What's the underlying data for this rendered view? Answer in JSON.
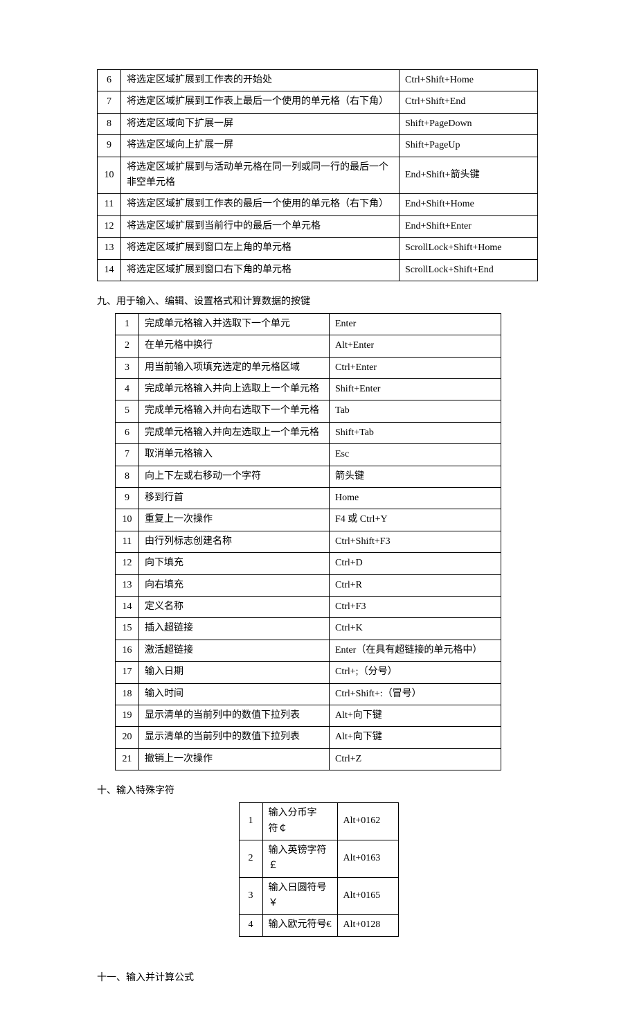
{
  "table1": {
    "rows": [
      {
        "num": "6",
        "desc": "将选定区域扩展到工作表的开始处",
        "key": "Ctrl+Shift+Home"
      },
      {
        "num": "7",
        "desc": "将选定区域扩展到工作表上最后一个使用的单元格（右下角）",
        "key": "Ctrl+Shift+End"
      },
      {
        "num": "8",
        "desc": "将选定区域向下扩展一屏",
        "key": "Shift+PageDown"
      },
      {
        "num": "9",
        "desc": "将选定区域向上扩展一屏",
        "key": "Shift+PageUp"
      },
      {
        "num": "10",
        "desc": "将选定区域扩展到与活动单元格在同一列或同一行的最后一个非空单元格",
        "key": "End+Shift+箭头键"
      },
      {
        "num": "11",
        "desc": "将选定区域扩展到工作表的最后一个使用的单元格（右下角）",
        "key": "End+Shift+Home"
      },
      {
        "num": "12",
        "desc": "将选定区域扩展到当前行中的最后一个单元格",
        "key": "End+Shift+Enter"
      },
      {
        "num": "13",
        "desc": "将选定区域扩展到窗口左上角的单元格",
        "key": "ScrollLock+Shift+Home"
      },
      {
        "num": "14",
        "desc": "将选定区域扩展到窗口右下角的单元格",
        "key": "ScrollLock+Shift+End"
      }
    ]
  },
  "section9": {
    "title": "九、用于输入、编辑、设置格式和计算数据的按键",
    "rows": [
      {
        "num": "1",
        "desc": "完成单元格输入并选取下一个单元",
        "key": "Enter"
      },
      {
        "num": "2",
        "desc": "在单元格中换行",
        "key": "Alt+Enter"
      },
      {
        "num": "3",
        "desc": "用当前输入项填充选定的单元格区域",
        "key": "Ctrl+Enter"
      },
      {
        "num": "4",
        "desc": "完成单元格输入并向上选取上一个单元格",
        "key": "Shift+Enter"
      },
      {
        "num": "5",
        "desc": "完成单元格输入并向右选取下一个单元格",
        "key": "Tab"
      },
      {
        "num": "6",
        "desc": "完成单元格输入并向左选取上一个单元格",
        "key": "Shift+Tab"
      },
      {
        "num": "7",
        "desc": "取消单元格输入",
        "key": "Esc"
      },
      {
        "num": "8",
        "desc": "向上下左或右移动一个字符",
        "key": "箭头键"
      },
      {
        "num": "9",
        "desc": "移到行首",
        "key": "Home"
      },
      {
        "num": "10",
        "desc": "重复上一次操作",
        "key": "F4 或 Ctrl+Y"
      },
      {
        "num": "11",
        "desc": "由行列标志创建名称",
        "key": "Ctrl+Shift+F3"
      },
      {
        "num": "12",
        "desc": "向下填充",
        "key": "Ctrl+D"
      },
      {
        "num": "13",
        "desc": "向右填充",
        "key": "Ctrl+R"
      },
      {
        "num": "14",
        "desc": "定义名称",
        "key": "Ctrl+F3"
      },
      {
        "num": "15",
        "desc": "插入超链接",
        "key": "Ctrl+K"
      },
      {
        "num": "16",
        "desc": "激活超链接",
        "key": "Enter（在具有超链接的单元格中）"
      },
      {
        "num": "17",
        "desc": "输入日期",
        "key": "Ctrl+;（分号）"
      },
      {
        "num": "18",
        "desc": "输入时间",
        "key": "Ctrl+Shift+:（冒号）"
      },
      {
        "num": "19",
        "desc": "显示清单的当前列中的数值下拉列表",
        "key": "Alt+向下键"
      },
      {
        "num": "20",
        "desc": "显示清单的当前列中的数值下拉列表",
        "key": "Alt+向下键"
      },
      {
        "num": "21",
        "desc": "撤销上一次操作",
        "key": "Ctrl+Z"
      }
    ]
  },
  "section10": {
    "title": "十、输入特殊字符",
    "rows": [
      {
        "num": "1",
        "desc": "输入分币字符￠",
        "key": "Alt+0162"
      },
      {
        "num": "2",
        "desc": "输入英镑字符￡",
        "key": "Alt+0163"
      },
      {
        "num": "3",
        "desc": "输入日圆符号￥",
        "key": "Alt+0165"
      },
      {
        "num": "4",
        "desc": "输入欧元符号€",
        "key": "Alt+0128"
      }
    ]
  },
  "section11": {
    "title": "十一、输入并计算公式"
  }
}
